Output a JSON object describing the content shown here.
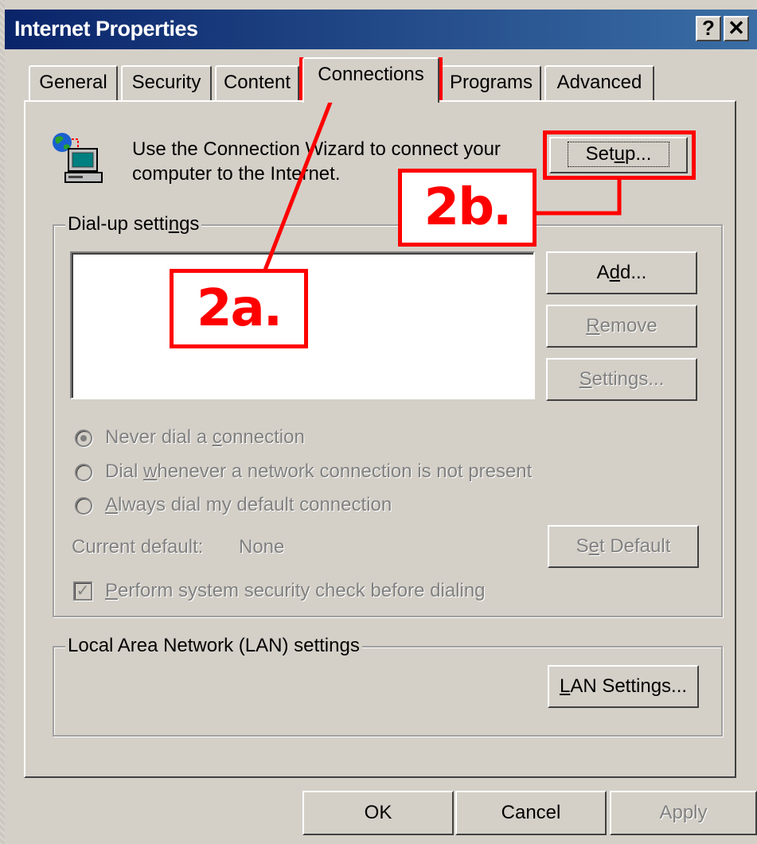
{
  "window": {
    "title": "Internet Properties",
    "help_glyph": "?",
    "close_glyph": "✕"
  },
  "tabs": [
    {
      "label": "General"
    },
    {
      "label": "Security"
    },
    {
      "label": "Content"
    },
    {
      "label": "Connections"
    },
    {
      "label": "Programs"
    },
    {
      "label": "Advanced"
    }
  ],
  "wizard": {
    "line1": "Use the Connection Wizard to connect your",
    "line2": "computer to the Internet.",
    "setup_pre": "Set",
    "setup_ul": "u",
    "setup_post": "p..."
  },
  "dialup": {
    "group_pre": "Dial-up setti",
    "group_ul": "n",
    "group_post": "gs",
    "add_pre": "A",
    "add_ul": "d",
    "add_post": "d...",
    "remove_ul": "R",
    "remove_post": "emove",
    "settings_ul": "S",
    "settings_post": "ettings...",
    "radio1_pre": "Never dial a ",
    "radio1_ul": "c",
    "radio1_post": "onnection",
    "radio2_pre": "Dial ",
    "radio2_ul": "w",
    "radio2_post": "henever a network connection is not present",
    "radio3_ul": "A",
    "radio3_post": "lways dial my default connection",
    "current_default_label": "Current default:",
    "current_default_value": "None",
    "setdefault_pre": "S",
    "setdefault_ul": "e",
    "setdefault_post": "t Default",
    "check_ul": "P",
    "check_post": "erform system security check before dialing",
    "check_mark": "✓",
    "selected_radio": 1
  },
  "lan": {
    "group_label": "Local Area Network (LAN) settings",
    "button_ul": "L",
    "button_post": "AN Settings..."
  },
  "footer": {
    "ok": "OK",
    "cancel": "Cancel",
    "apply": "Apply"
  },
  "annotations": {
    "callout_a": "2a.",
    "callout_b": "2b.",
    "color": "#ff0000"
  }
}
